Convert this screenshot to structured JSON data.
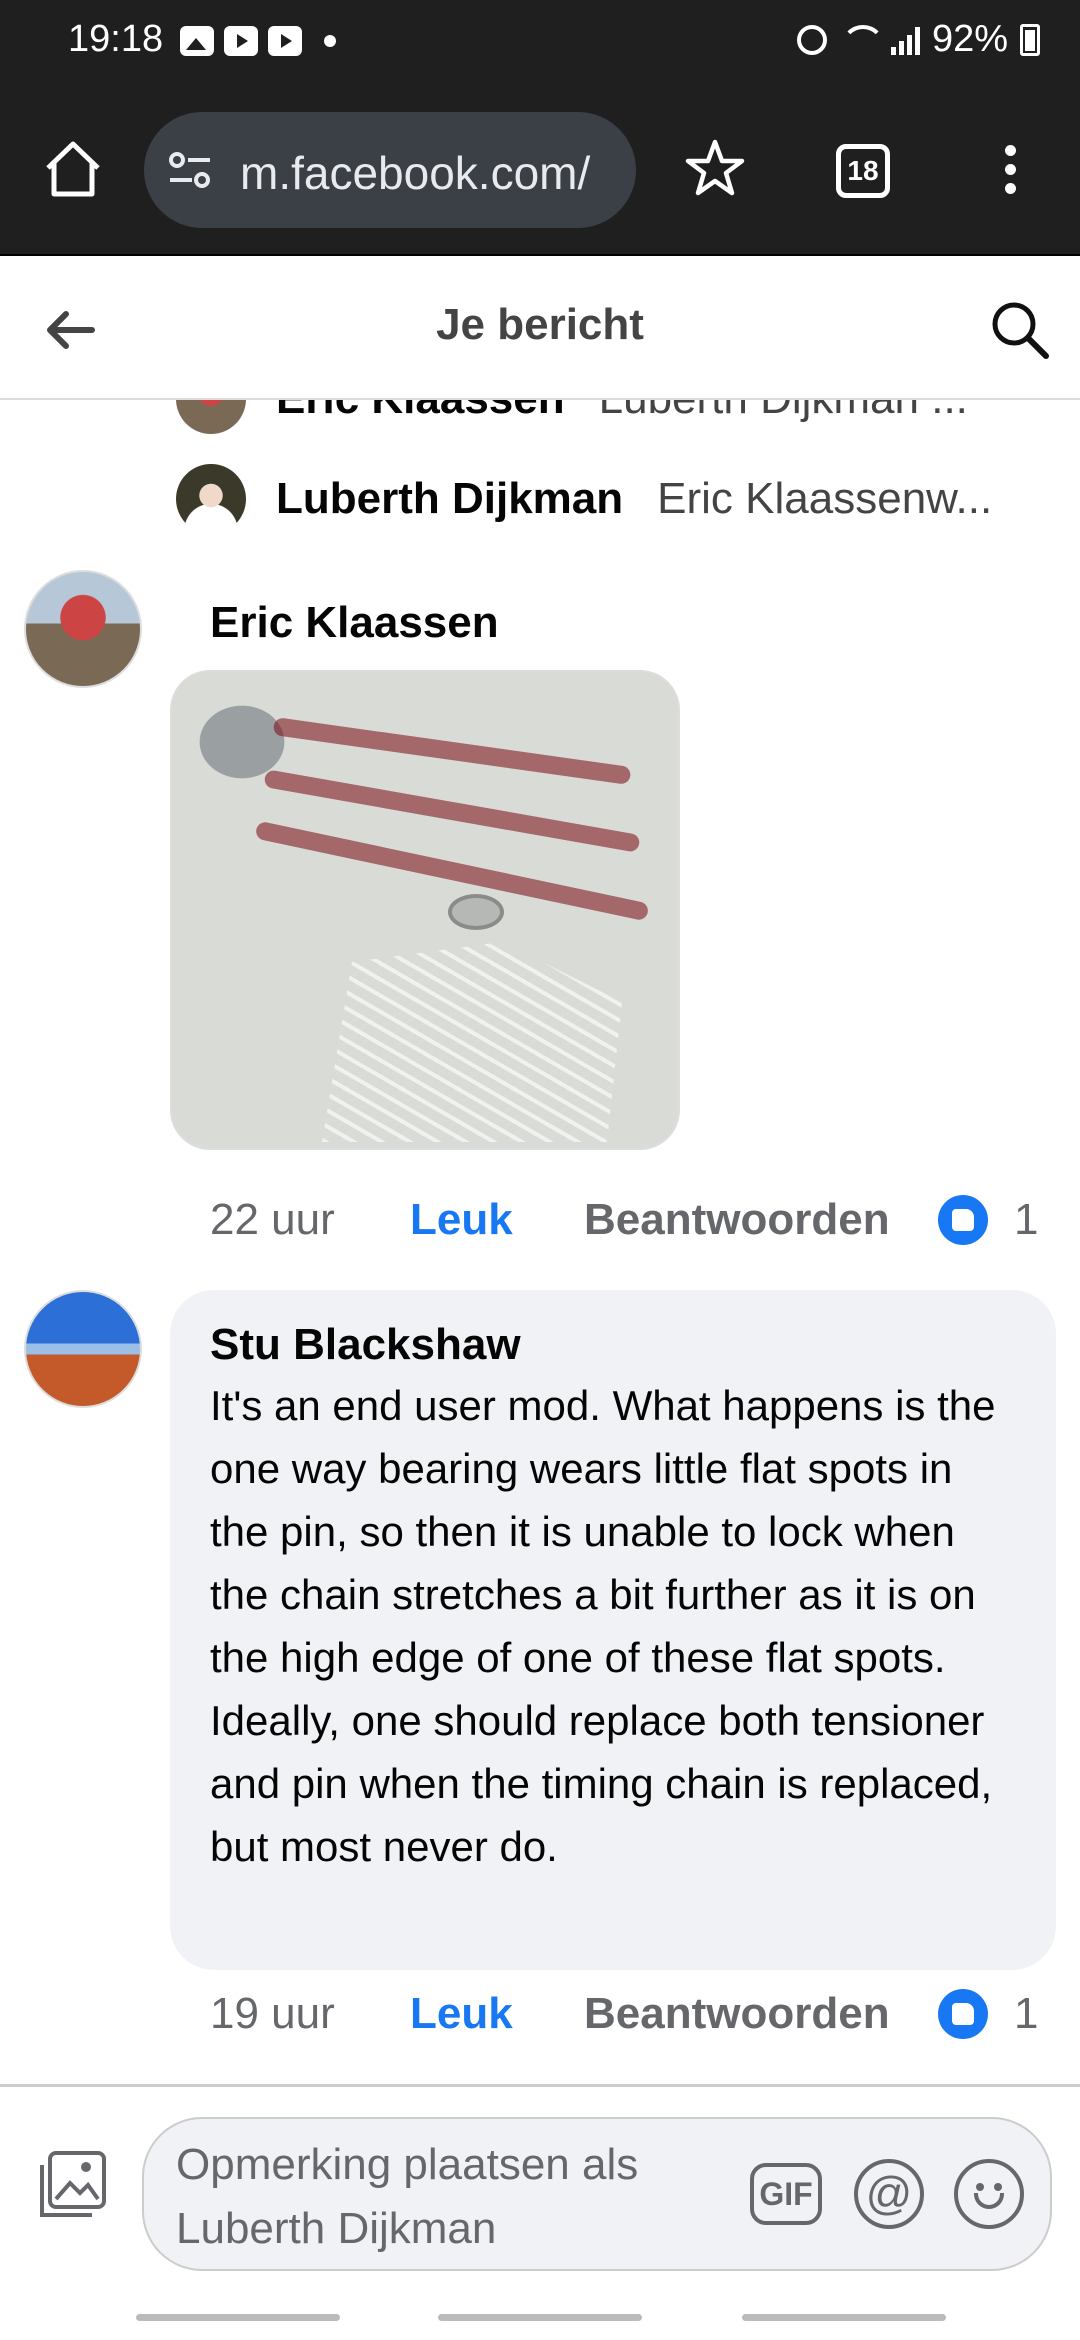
{
  "status_bar": {
    "time": "19:18",
    "battery": "92%"
  },
  "browser": {
    "url": "m.facebook.com/",
    "tab_count": "18"
  },
  "header": {
    "title": "Je bericht"
  },
  "replies_preview": [
    {
      "name": "Eric Klaassen",
      "snippet": "Luberth Dijkman ..."
    },
    {
      "name": "Luberth Dijkman",
      "snippet": "Eric Klaassenw..."
    }
  ],
  "comments": [
    {
      "author": "Eric Klaassen",
      "time": "22 uur",
      "like_label": "Leuk",
      "reply_label": "Beantwoorden",
      "reaction_count": "1"
    },
    {
      "author": "Stu Blackshaw",
      "text": "It's an end user mod.  What happens is the one way bearing wears little flat spots in the pin, so then it is unable to lock when the chain stretches a bit further as it is on the high edge of one of these flat spots.  Ideally, one should replace both tensioner and pin when the timing chain is replaced, but most never do.",
      "time": "19 uur",
      "like_label": "Leuk",
      "reply_label": "Beantwoorden",
      "reaction_count": "1"
    }
  ],
  "composer": {
    "placeholder": "Opmerking plaatsen als Luberth Dijkman",
    "gif_label": "GIF",
    "at_label": "@"
  },
  "icons": [
    "home-icon",
    "site-settings-icon",
    "star-icon",
    "tabs-icon",
    "overflow-menu-icon",
    "back-arrow-icon",
    "search-icon",
    "photo-upload-icon",
    "gif-icon",
    "mention-icon",
    "emoji-icon",
    "like-reaction-icon"
  ],
  "colors": {
    "accent": "#1877f2",
    "bubble": "#f0f2f5",
    "browser_bar": "#1f1f1f"
  }
}
